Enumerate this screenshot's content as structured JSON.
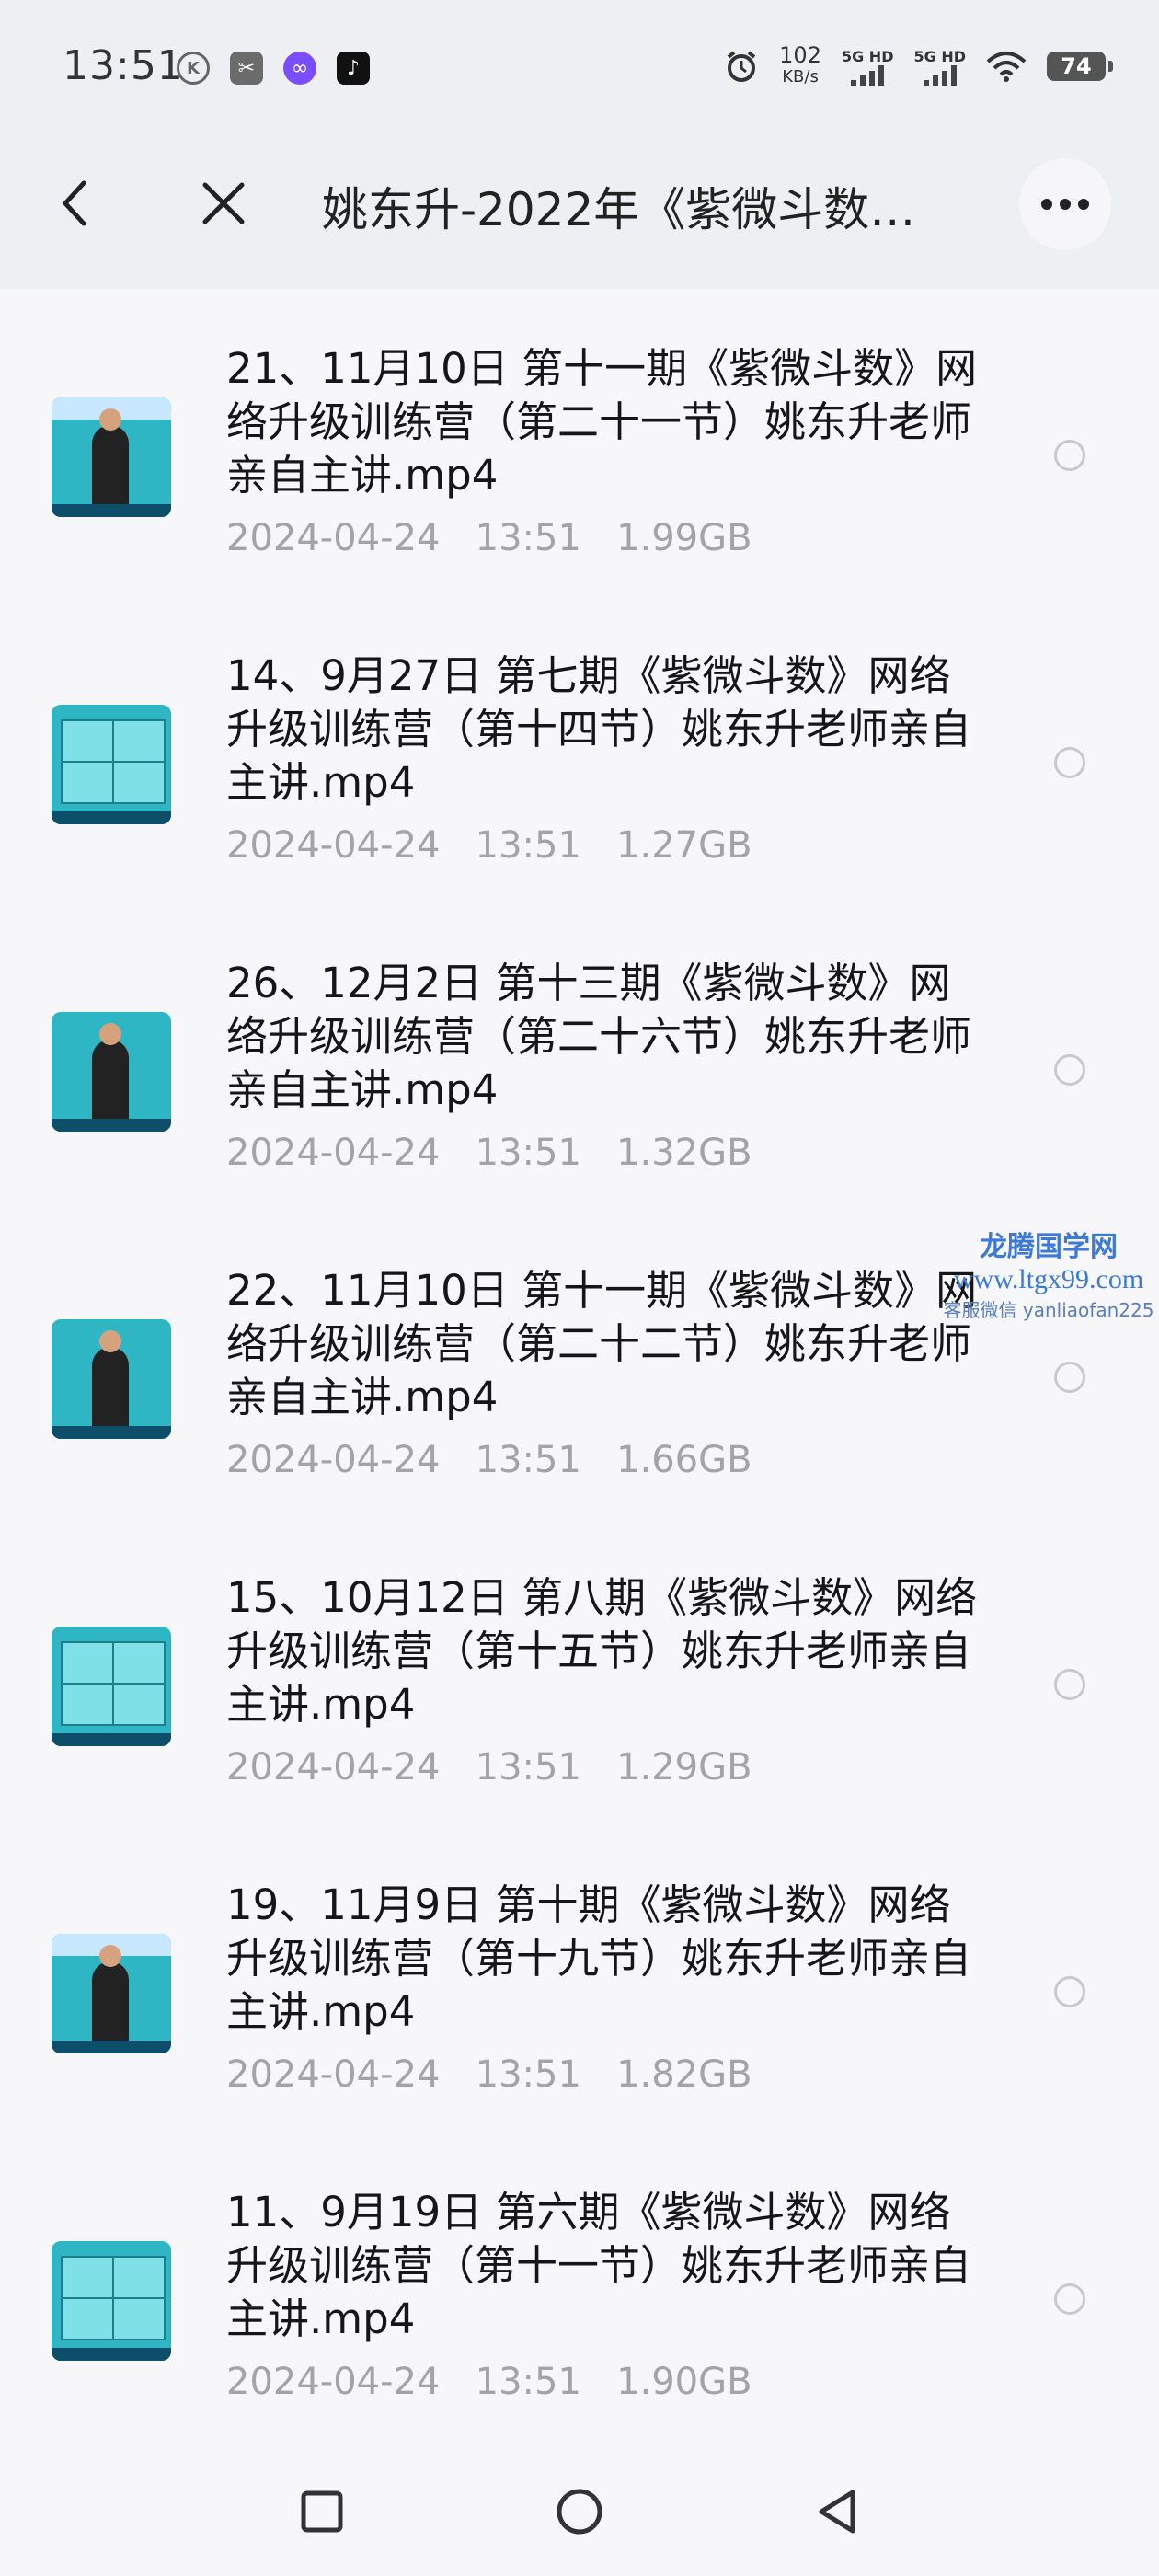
{
  "status_bar": {
    "time": "13:51",
    "k_icon": "K",
    "speed_value": "102",
    "speed_unit": "KB/s",
    "sim1": "5G HD",
    "sim2": "5G HD",
    "battery": "74"
  },
  "title_bar": {
    "title": "姚东升-2022年《紫微斗数…"
  },
  "files": [
    {
      "name": "21、11月10日 第十一期《紫微斗数》网络升级训练营（第二十一节）姚东升老师亲自主讲.mp4",
      "date": "2024-04-24",
      "time": "13:51",
      "size": "1.99GB"
    },
    {
      "name": "14、9月27日 第七期《紫微斗数》网络升级训练营（第十四节）姚东升老师亲自主讲.mp4",
      "date": "2024-04-24",
      "time": "13:51",
      "size": "1.27GB"
    },
    {
      "name": "26、12月2日 第十三期《紫微斗数》网络升级训练营（第二十六节）姚东升老师亲自主讲.mp4",
      "date": "2024-04-24",
      "time": "13:51",
      "size": "1.32GB"
    },
    {
      "name": "22、11月10日 第十一期《紫微斗数》网络升级训练营（第二十二节）姚东升老师亲自主讲.mp4",
      "date": "2024-04-24",
      "time": "13:51",
      "size": "1.66GB"
    },
    {
      "name": "15、10月12日 第八期《紫微斗数》网络升级训练营（第十五节）姚东升老师亲自主讲.mp4",
      "date": "2024-04-24",
      "time": "13:51",
      "size": "1.29GB"
    },
    {
      "name": "19、11月9日 第十期《紫微斗数》网络升级训练营（第十九节）姚东升老师亲自主讲.mp4",
      "date": "2024-04-24",
      "time": "13:51",
      "size": "1.82GB"
    },
    {
      "name": "11、9月19日 第六期《紫微斗数》网络升级训练营（第十一节）姚东升老师亲自主讲.mp4",
      "date": "2024-04-24",
      "time": "13:51",
      "size": "1.90GB"
    }
  ],
  "watermark": {
    "line1": "龙腾国学网",
    "line2": "www.ltgx99.com",
    "line3": "客服微信 yanliaofan225"
  },
  "colors": {
    "header_bg": "#eeeff2",
    "page_bg": "#f7f7f9",
    "meta_text": "#a3a3a8",
    "watermark": "#3d7ad6"
  }
}
